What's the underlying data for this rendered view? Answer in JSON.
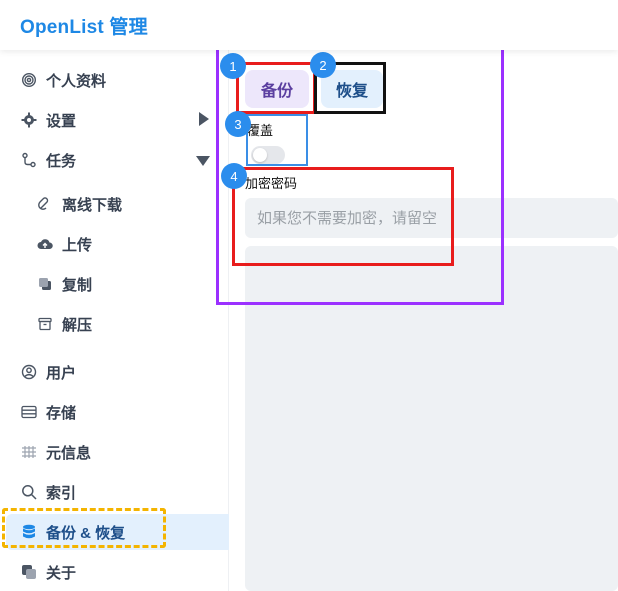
{
  "header": {
    "title": "OpenList 管理"
  },
  "sidebar": {
    "items": [
      {
        "label": "个人资料",
        "icon": "fingerprint-icon"
      },
      {
        "label": "设置",
        "icon": "gear-icon",
        "expander": "chevron-right-icon"
      },
      {
        "label": "任务",
        "icon": "workflow-icon",
        "expander": "chevron-down-icon"
      },
      {
        "label": "离线下载",
        "icon": "magnet-icon"
      },
      {
        "label": "上传",
        "icon": "cloud-upload-icon"
      },
      {
        "label": "复制",
        "icon": "copy-icon"
      },
      {
        "label": "解压",
        "icon": "archive-icon"
      },
      {
        "label": "用户",
        "icon": "user-circle-icon"
      },
      {
        "label": "存储",
        "icon": "storage-icon"
      },
      {
        "label": "元信息",
        "icon": "meta-icon"
      },
      {
        "label": "索引",
        "icon": "search-icon"
      },
      {
        "label": "备份 & 恢复",
        "icon": "database-icon",
        "active": true
      },
      {
        "label": "关于",
        "icon": "info-icon"
      }
    ]
  },
  "main": {
    "backup_label": "备份",
    "restore_label": "恢复",
    "overwrite_label": "覆盖",
    "overwrite_enabled": false,
    "password_label": "加密密码",
    "password_placeholder": "如果您不需要加密，请留空",
    "password_value": ""
  },
  "annotations": {
    "badges": [
      "1",
      "2",
      "3",
      "4"
    ],
    "colors": {
      "outer": "#9b30ff",
      "red": "#e81c1c",
      "black": "#111111",
      "blue": "#3a8ee6",
      "yellow": "#f4b400"
    }
  }
}
